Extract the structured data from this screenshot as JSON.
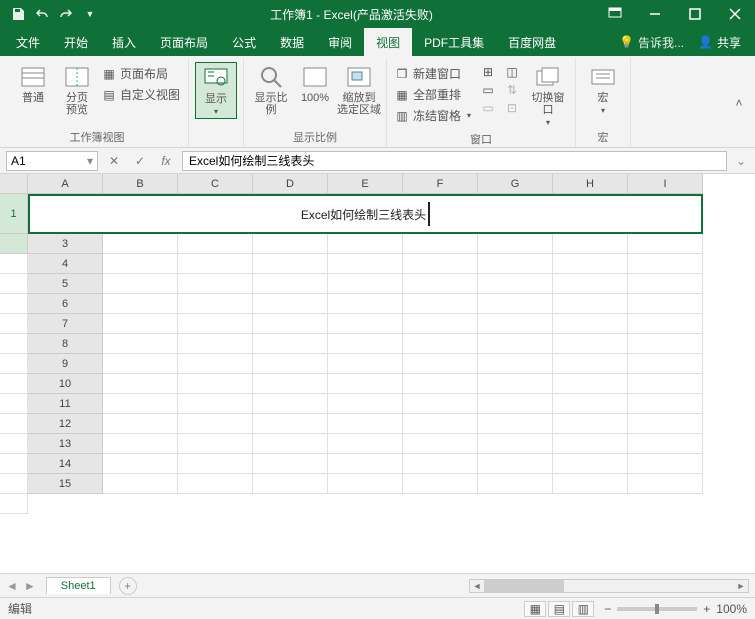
{
  "title": {
    "workbook": "工作簿1",
    "app": "Excel(产品激活失败)",
    "sep": " - "
  },
  "tabs": {
    "file": "文件",
    "home": "开始",
    "insert": "插入",
    "layout": "页面布局",
    "formula": "公式",
    "data": "数据",
    "review": "审阅",
    "view": "视图",
    "pdf": "PDF工具集",
    "baidu": "百度网盘",
    "tell": "告诉我...",
    "share": "共享"
  },
  "ribbon": {
    "viewsGroup": "工作簿视图",
    "normal": "普通",
    "pagebreak": "分页\n预览",
    "pagelayout": "页面布局",
    "custom": "自定义视图",
    "showGroup": "",
    "show": "显示",
    "zoomGroup": "显示比例",
    "zoom": "显示比例",
    "z100": "100%",
    "zoomsel": "缩放到\n选定区域",
    "windowGroup": "窗口",
    "newwin": "新建窗口",
    "arrange": "全部重排",
    "freeze": "冻结窗格",
    "switch": "切换窗口",
    "macroGroup": "宏",
    "macro": "宏"
  },
  "formula": {
    "nameRef": "A1",
    "fx": "fx",
    "value": "Excel如何绘制三线表头"
  },
  "cols": [
    "A",
    "B",
    "C",
    "D",
    "E",
    "F",
    "G",
    "H",
    "I"
  ],
  "rows": [
    "1",
    "",
    "3",
    "4",
    "5",
    "6",
    "7",
    "8",
    "9",
    "10",
    "11",
    "12",
    "13",
    "14",
    "15"
  ],
  "mergedText": "Excel如何绘制三线表头",
  "sheet": {
    "name": "Sheet1"
  },
  "status": {
    "mode": "编辑",
    "zoom": "100%"
  }
}
